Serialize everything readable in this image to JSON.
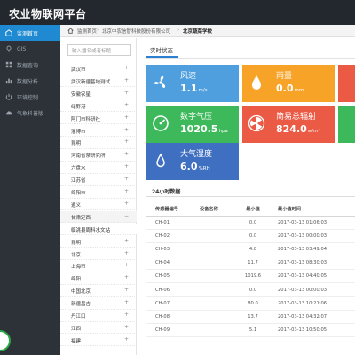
{
  "app": {
    "title": "农业物联网平台"
  },
  "sidebar": {
    "items": [
      {
        "label": "监测首页",
        "active": true,
        "icon": "dashboard-icon"
      },
      {
        "label": "GIS",
        "active": false,
        "icon": "map-pin-icon"
      },
      {
        "label": "数据查询",
        "active": false,
        "icon": "grid-icon"
      },
      {
        "label": "数据分析",
        "active": false,
        "icon": "bar-chart-icon"
      },
      {
        "label": "环境控制",
        "active": false,
        "icon": "control-icon"
      },
      {
        "label": "气象科普版",
        "active": false,
        "icon": "cloud-icon"
      }
    ]
  },
  "breadcrumb": {
    "items": [
      "监测首页",
      "北京中农信智科技股份有限公司",
      "北京蔬菜学校"
    ]
  },
  "tree": {
    "search_placeholder": "输入播名或者标题",
    "items": [
      {
        "label": "武汉市",
        "type": "node",
        "toggle": "+"
      },
      {
        "label": "武汉新疆基地测试",
        "type": "node",
        "toggle": "+"
      },
      {
        "label": "安徽农星",
        "type": "node",
        "toggle": "+"
      },
      {
        "label": "绿野港",
        "type": "node",
        "toggle": "+"
      },
      {
        "label": "阿门市科研社",
        "type": "node",
        "toggle": "+"
      },
      {
        "label": "淄博市",
        "type": "node",
        "toggle": "+"
      },
      {
        "label": "昆明",
        "type": "node",
        "toggle": "+"
      },
      {
        "label": "河南省茶研究所",
        "type": "node",
        "toggle": "+"
      },
      {
        "label": "六盘水",
        "type": "node",
        "toggle": "+"
      },
      {
        "label": "江苏省",
        "type": "node",
        "toggle": "+"
      },
      {
        "label": "绵阳市",
        "type": "node",
        "toggle": "+"
      },
      {
        "label": "遵义",
        "type": "node",
        "toggle": "+"
      },
      {
        "label": "甘肃定西",
        "type": "group",
        "toggle": "−"
      },
      {
        "label": "临洮县周科水文站",
        "type": "selected",
        "toggle": ""
      },
      {
        "label": "昆明",
        "type": "node",
        "toggle": "+"
      },
      {
        "label": "北京",
        "type": "node",
        "toggle": "+"
      },
      {
        "label": "上海市",
        "type": "node",
        "toggle": "+"
      },
      {
        "label": "绵阳",
        "type": "node",
        "toggle": "+"
      },
      {
        "label": "中国北京",
        "type": "node",
        "toggle": "+"
      },
      {
        "label": "新疆昌吉",
        "type": "node",
        "toggle": "+"
      },
      {
        "label": "丹江口",
        "type": "node",
        "toggle": "+"
      },
      {
        "label": "江西",
        "type": "node",
        "toggle": "+"
      },
      {
        "label": "福建",
        "type": "node",
        "toggle": "+"
      }
    ]
  },
  "main": {
    "tab_label": "实时状态",
    "cards": [
      {
        "name": "风速",
        "value": "1.1",
        "unit": "m/s",
        "color": "blue",
        "icon": "fan-icon"
      },
      {
        "name": "雨量",
        "value": "0.0",
        "unit": "mm",
        "color": "orange",
        "icon": "raindrop-icon"
      },
      {
        "name": "数字气压",
        "value": "1020.5",
        "unit": "hpa",
        "color": "green",
        "icon": "gauge-icon"
      },
      {
        "name": "简易总辐射",
        "value": "824.0",
        "unit": "w/m²",
        "color": "red",
        "icon": "radiation-icon"
      },
      {
        "name": "大气湿度",
        "value": "6.0",
        "unit": "%RH",
        "color": "navy",
        "icon": "humidity-icon"
      }
    ],
    "table_title": "24小时数据",
    "table": {
      "columns": [
        "传感器编号",
        "设备名称",
        "最小值",
        "最小值时间"
      ],
      "rows": [
        [
          "CH-01",
          "",
          "0.0",
          "2017-03-13 01:06:03"
        ],
        [
          "CH-02",
          "",
          "0.0",
          "2017-03-13 00:00:03"
        ],
        [
          "CH-03",
          "",
          "4.8",
          "2017-03-13 03:49:04"
        ],
        [
          "CH-04",
          "",
          "11.7",
          "2017-03-13 08:30:03"
        ],
        [
          "CH-05",
          "",
          "1019.6",
          "2017-03-13 04:40:05"
        ],
        [
          "CH-06",
          "",
          "0.0",
          "2017-03-13 00:00:03"
        ],
        [
          "CH-07",
          "",
          "80.0",
          "2017-03-13 10:21:06"
        ],
        [
          "CH-08",
          "",
          "13.7",
          "2017-03-13 04:32:07"
        ],
        [
          "CH-09",
          "",
          "5.1",
          "2017-03-13 10:50:05"
        ]
      ]
    }
  }
}
